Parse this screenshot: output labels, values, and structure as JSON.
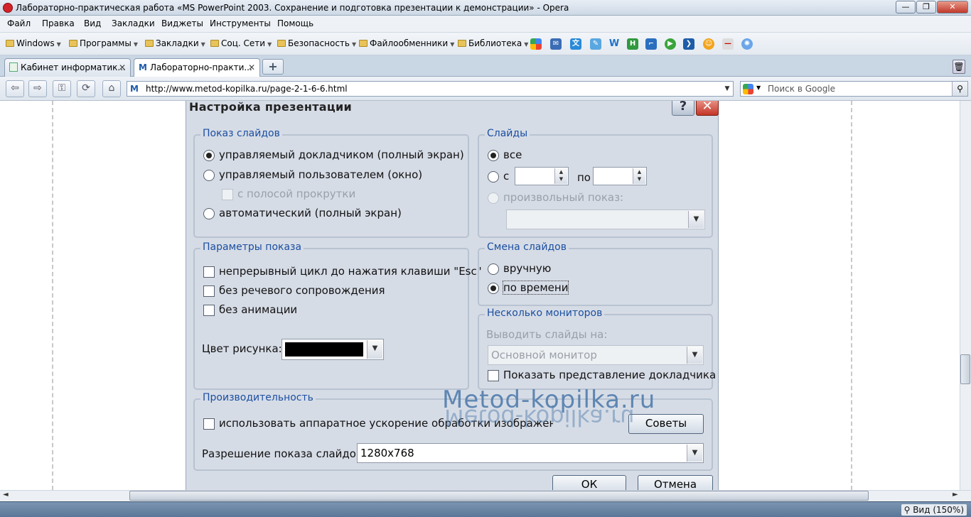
{
  "window": {
    "title": "Лабораторно-практическая работа «MS PowerPoint 2003. Сохранение и подготовка презентации к демонстрации» - Opera",
    "minimize": "—",
    "maximize": "❐",
    "close": "✕"
  },
  "menu": [
    "Файл",
    "Правка",
    "Вид",
    "Закладки",
    "Виджеты",
    "Инструменты",
    "Помощь"
  ],
  "bookmarks": [
    "Windows",
    "Программы",
    "Закладки",
    "Соц. Сети",
    "Безопасность",
    "Файлообменники",
    "Библиотека"
  ],
  "tabs": [
    {
      "label": "Кабинет информатик...",
      "close": "✕"
    },
    {
      "label": "Лабораторно-практи...",
      "close": "✕"
    }
  ],
  "new_tab": "+",
  "nav": {
    "url": "http://www.metod-kopilka.ru/page-2-1-6-6.html",
    "favicon": "M",
    "search_placeholder": "Поиск в Google"
  },
  "dialog": {
    "title": "Настройка презентации",
    "help": "?",
    "close": "✕",
    "show_group": {
      "title": "Показ слайдов",
      "opt_presenter": "управляемый докладчиком (полный экран)",
      "opt_user": "управляемый пользователем (окно)",
      "opt_scrollbar": "с полосой прокрутки",
      "opt_auto": "автоматический (полный экран)"
    },
    "slides_group": {
      "title": "Слайды",
      "opt_all": "все",
      "opt_from": "с",
      "to_label": "по",
      "opt_custom": "произвольный показ:"
    },
    "params_group": {
      "title": "Параметры показа",
      "loop": "непрерывный цикл до нажатия клавиши \"Esc\"",
      "no_narration": "без речевого сопровождения",
      "no_animation": "без анимации",
      "pen_color_label": "Цвет рисунка:",
      "pen_color": "#000000"
    },
    "advance_group": {
      "title": "Смена слайдов",
      "manual": "вручную",
      "timed": "по времени"
    },
    "monitors_group": {
      "title": "Несколько мониторов",
      "display_on": "Выводить слайды на:",
      "monitor": "Основной монитор",
      "presenter_view": "Показать представление докладчика"
    },
    "perf_group": {
      "title": "Производительность",
      "hw_accel": "использовать аппаратное ускорение обработки изображения",
      "tips": "Советы",
      "resolution_label": "Разрешение показа слайдов:",
      "resolution": "1280x768"
    },
    "ok": "ОК",
    "cancel": "Отмена"
  },
  "watermark": "Metod-kopilka.ru",
  "status": {
    "zoom": "Вид (150%)"
  }
}
